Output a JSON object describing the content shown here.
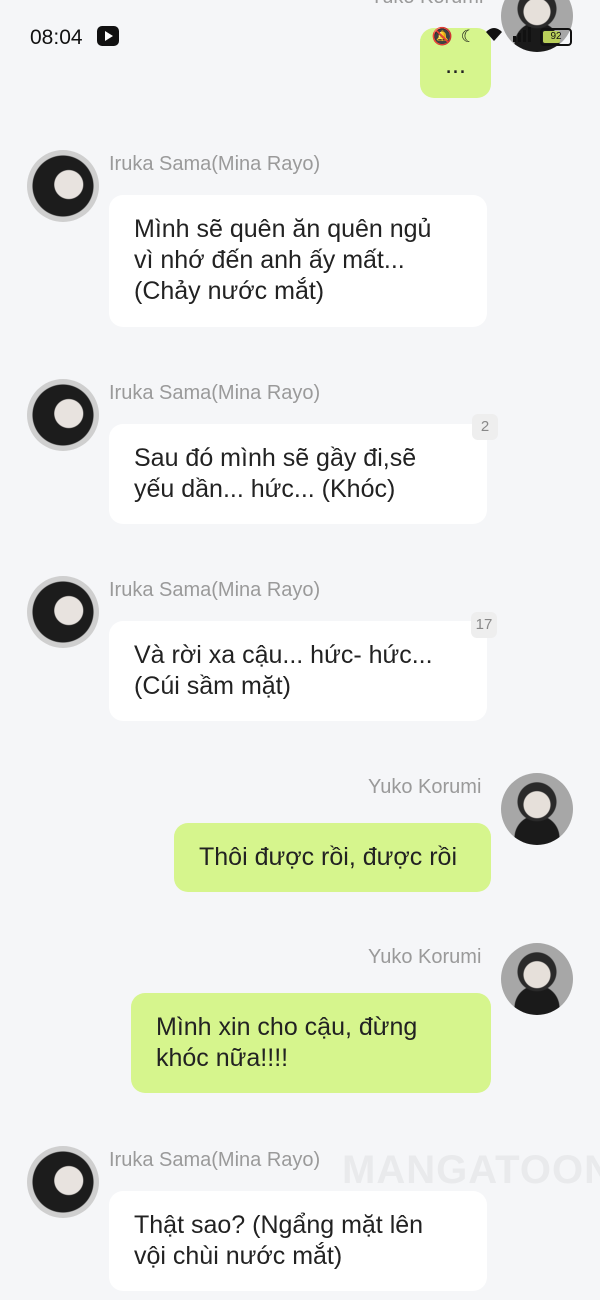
{
  "status_bar": {
    "time": "08:04",
    "app_icon": "video-play-icon",
    "icons": [
      "mute-bell-icon",
      "moon-icon",
      "wifi-icon",
      "signal-icon"
    ],
    "battery": "92"
  },
  "users": {
    "left_name": "Iruka Sama(Mina Rayo)",
    "right_name": "Yuko Korumi"
  },
  "messages": [
    {
      "side": "right",
      "sender": "Yuko Korumi",
      "text": "...",
      "color": "#d6f58d"
    },
    {
      "side": "left",
      "sender": "Iruka Sama(Mina Rayo)",
      "lines": [
        "Mình sẽ quên ăn quên ngủ",
        "vì nhớ đến anh ấy mất...",
        "(Chảy nước mắt)"
      ]
    },
    {
      "side": "left",
      "sender": "Iruka Sama(Mina Rayo)",
      "lines": [
        "Sau đó mình sẽ gầy đi,sẽ",
        "yếu dần... hức... (Khóc)"
      ],
      "badge": "2"
    },
    {
      "side": "left",
      "sender": "Iruka Sama(Mina Rayo)",
      "lines": [
        "Và rời xa cậu... hức- hức...",
        "(Cúi sầm mặt)"
      ],
      "badge": "17"
    },
    {
      "side": "right",
      "sender": "Yuko Korumi",
      "lines": [
        "Thôi được rồi, được rồi"
      ]
    },
    {
      "side": "right",
      "sender": "Yuko Korumi",
      "lines": [
        "Mình xin cho cậu, đừng",
        "khóc nữa!!!!"
      ]
    },
    {
      "side": "left",
      "sender": "Iruka Sama(Mina Rayo)",
      "lines": [
        "Thật sao? (Ngẩng mặt lên",
        "vội chùi nước mắt)"
      ]
    }
  ],
  "watermark": "MANGATOON",
  "colors": {
    "background": "#f5f6f8",
    "bubble_green": "#d6f58d",
    "bubble_white": "#ffffff",
    "name_gray": "#9a9a9a"
  }
}
